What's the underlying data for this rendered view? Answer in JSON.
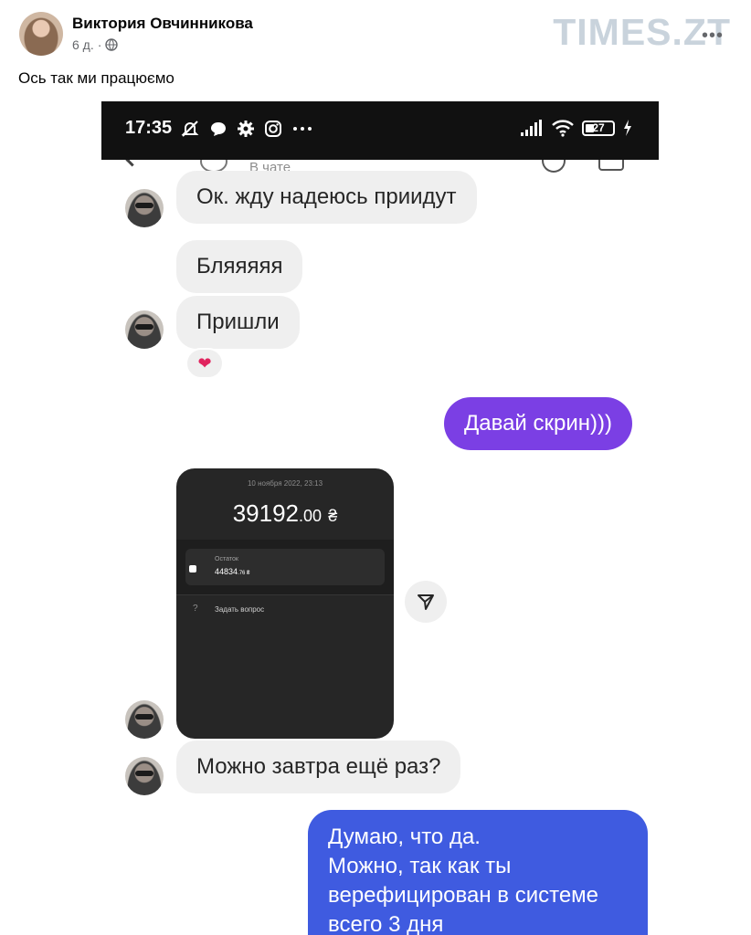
{
  "post": {
    "author": "Виктория Овчинникова",
    "time": "6 д.",
    "separator": "·",
    "privacy_icon": "globe-icon",
    "text": "Ось так ми працюємо",
    "more_icon": "more-horizontal-icon"
  },
  "watermark": "TIMES.ZT",
  "phone": {
    "status_time": "17:35",
    "battery": "27",
    "status_icons_left": [
      "mute-bell-icon",
      "chat-bubble-icon",
      "gear-icon",
      "instagram-icon",
      "ellipsis-icon"
    ],
    "status_icons_right": [
      "signal-icon",
      "wifi-icon",
      "battery-icon",
      "charging-icon"
    ]
  },
  "chat": {
    "status": "В чате",
    "messages": [
      {
        "direction": "in",
        "text": "Ок. жду надеюсь приидут"
      },
      {
        "direction": "in",
        "text": "Бляяяяя"
      },
      {
        "direction": "in",
        "text": "Пришли",
        "reaction": "❤"
      },
      {
        "direction": "out",
        "text": "Давай скрин)))"
      },
      {
        "direction": "in",
        "type": "image"
      },
      {
        "direction": "in",
        "text": "Можно завтра ещё раз?"
      },
      {
        "direction": "out",
        "lines": [
          "Думаю, что да.",
          "Можно, так как ты",
          "верефицирован в системе",
          "всего 3 дня"
        ]
      }
    ],
    "receipt": {
      "date": "10 ноября 2022, 23:13",
      "amount_main": "39192",
      "amount_fraction": ".00",
      "currency": "₴",
      "balance_label": "Остаток",
      "balance_main": "44834",
      "balance_fraction": ".76 ₴",
      "question_mark": "?",
      "question_label": "Задать вопрос"
    },
    "colors": {
      "outgoing_purple": "#7b3fe4",
      "outgoing_blue": "#3f5be0",
      "incoming": "#efefef"
    }
  }
}
